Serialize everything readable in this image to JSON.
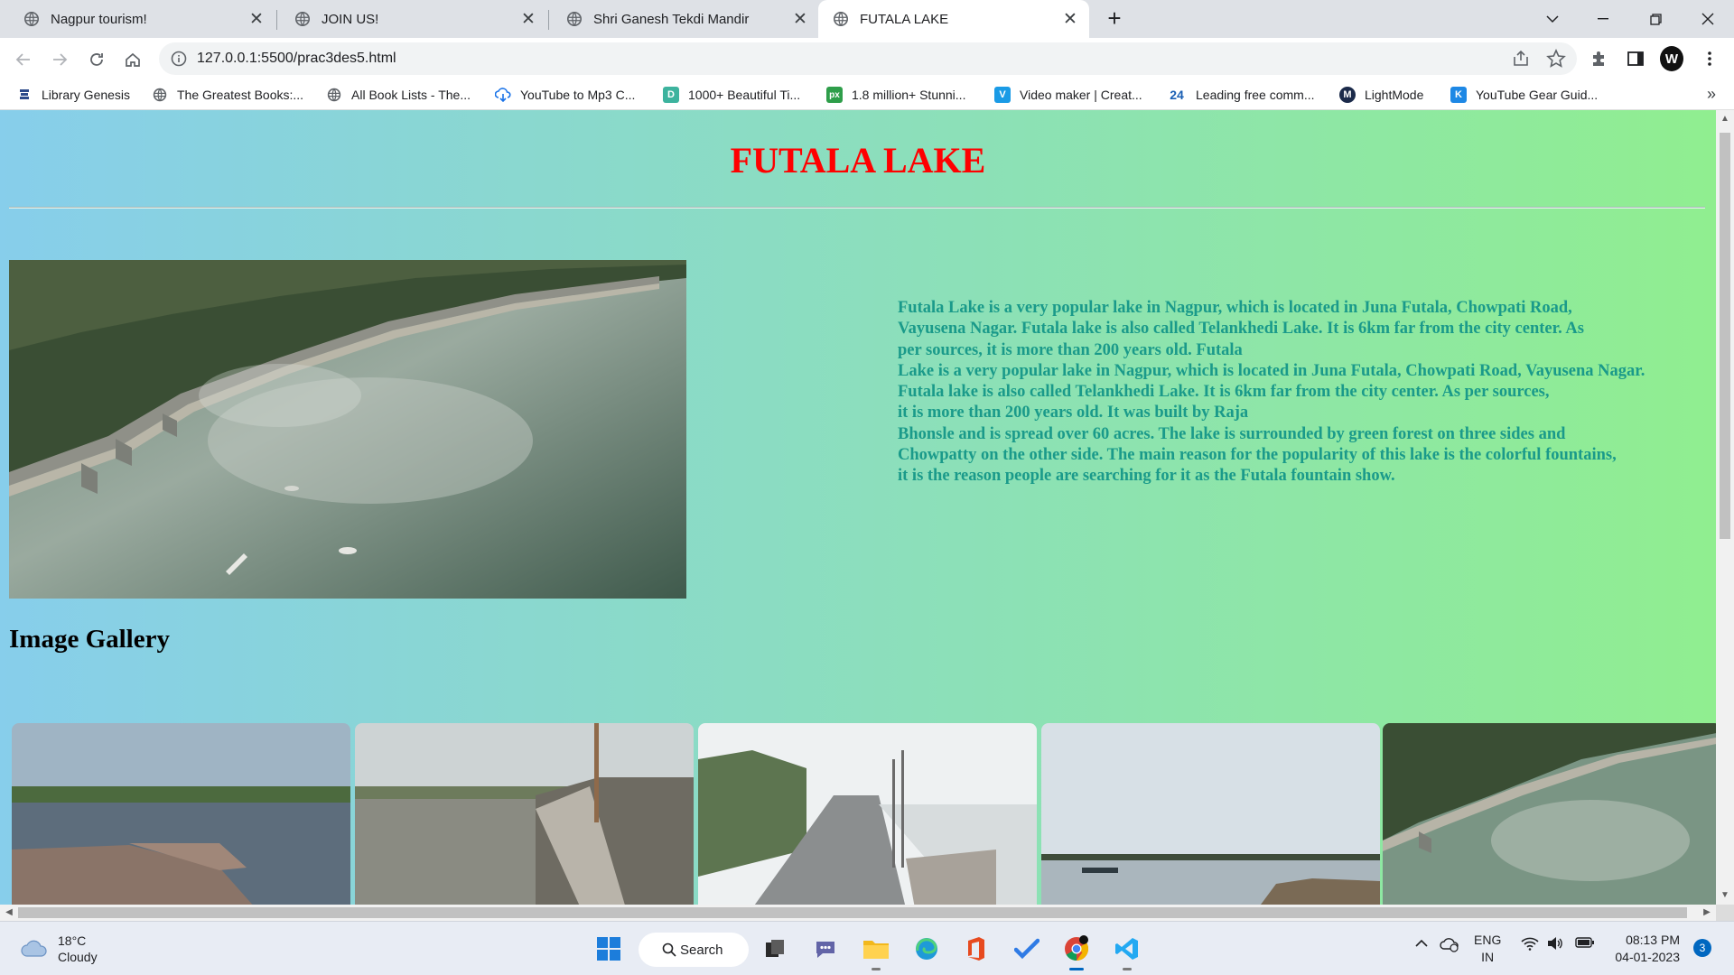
{
  "browser": {
    "tabs": [
      {
        "title": "Nagpur tourism!",
        "active": false
      },
      {
        "title": "JOIN US!",
        "active": false
      },
      {
        "title": "Shri Ganesh Tekdi Mandir",
        "active": false
      },
      {
        "title": "FUTALA LAKE",
        "active": true
      }
    ],
    "url": "127.0.0.1:5500/prac3des5.html",
    "bookmarks": [
      {
        "label": "Library Genesis",
        "icon": "library-genesis-icon"
      },
      {
        "label": "The Greatest Books:...",
        "icon": "globe-icon"
      },
      {
        "label": "All Book Lists - The...",
        "icon": "globe-icon"
      },
      {
        "label": "YouTube to Mp3 C...",
        "icon": "cloud-download-icon"
      },
      {
        "label": "1000+ Beautiful Ti...",
        "icon": "d-logo-icon"
      },
      {
        "label": "1.8 million+ Stunni...",
        "icon": "px-logo-icon"
      },
      {
        "label": "Video maker | Creat...",
        "icon": "v-logo-icon"
      },
      {
        "label": "Leading free comm...",
        "icon": "24-logo-icon"
      },
      {
        "label": "LightMode",
        "icon": "lightmode-icon"
      },
      {
        "label": "YouTube Gear Guid...",
        "icon": "k-logo-icon"
      }
    ]
  },
  "page": {
    "title": "FUTALA LAKE",
    "description_lines": [
      "Futala Lake is a very popular lake in Nagpur, which is located in Juna Futala, Chowpati Road,",
      "Vayusena Nagar. Futala lake is also called Telankhedi Lake. It is 6km far from the city center. As",
      "per sources, it is more than 200 years old. Futala",
      "Lake is a very popular lake in Nagpur, which is located in Juna Futala, Chowpati Road, Vayusena Nagar.",
      "Futala lake is also called Telankhedi Lake. It is 6km far from the city center. As per sources,",
      "it is more than 200 years old. It was built by Raja",
      "Bhonsle and is spread over 60 acres. The lake is surrounded by green forest on three sides and",
      "Chowpatty on the other side. The main reason for the popularity of this lake is the colorful fountains,",
      "it is the reason people are searching for it as the Futala fountain show."
    ],
    "gallery_heading": "Image Gallery"
  },
  "taskbar": {
    "weather_temp": "18°C",
    "weather_desc": "Cloudy",
    "search_label": "Search",
    "lang_line1": "ENG",
    "lang_line2": "IN",
    "time": "08:13 PM",
    "date": "04-01-2023",
    "notification_count": "3"
  },
  "colors": {
    "title_red": "#ff0000",
    "desc_teal": "#1a9a8a",
    "gradient_start": "#87ceeb",
    "gradient_end": "#90ee90"
  }
}
